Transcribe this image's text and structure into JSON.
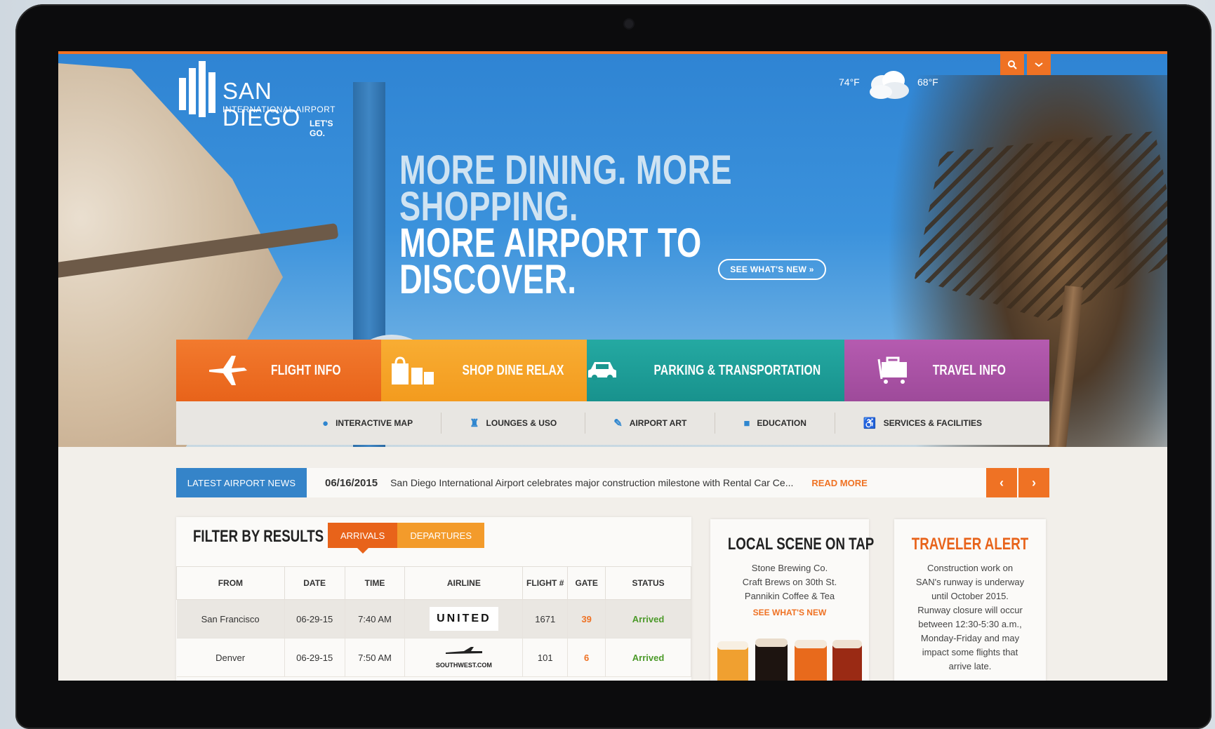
{
  "brand": {
    "name": "SAN DIEGO",
    "subtitle": "INTERNATIONAL AIRPORT",
    "tagline": "LET'S GO."
  },
  "weather": {
    "high": "74°F",
    "low": "68°F",
    "icon": "cloud-icon"
  },
  "hero": {
    "line1": "MORE DINING. MORE SHOPPING.",
    "line2": "MORE AIRPORT TO DISCOVER.",
    "cta": "SEE WHAT'S NEW »"
  },
  "nav_tiles": [
    {
      "label": "FLIGHT INFO",
      "icon": "airplane-icon",
      "color": "#ef7224"
    },
    {
      "label": "SHOP DINE RELAX",
      "icon": "shopping-bags-icon",
      "color": "#f5a52a"
    },
    {
      "label": "PARKING & TRANSPORTATION",
      "icon": "car-icon",
      "color": "#1fa19b"
    },
    {
      "label": "TRAVEL INFO",
      "icon": "luggage-icon",
      "color": "#a853a4"
    }
  ],
  "sub_nav": [
    {
      "label": "INTERACTIVE MAP",
      "icon": "map-pin-icon"
    },
    {
      "label": "LOUNGES & USO",
      "icon": "lounge-chair-icon"
    },
    {
      "label": "AIRPORT ART",
      "icon": "palette-icon"
    },
    {
      "label": "EDUCATION",
      "icon": "book-icon"
    },
    {
      "label": "SERVICES & FACILITIES",
      "icon": "accessibility-icon"
    }
  ],
  "news": {
    "label": "LATEST AIRPORT NEWS",
    "date": "06/16/2015",
    "text": "San Diego International Airport celebrates major construction milestone with Rental Car Ce...",
    "more": "READ MORE",
    "prev": "‹",
    "next": "›"
  },
  "flights": {
    "title": "FILTER BY RESULTS",
    "tabs": [
      "ARRIVALS",
      "DEPARTURES"
    ],
    "columns": [
      "FROM",
      "DATE",
      "TIME",
      "AIRLINE",
      "FLIGHT #",
      "GATE",
      "STATUS"
    ],
    "rows": [
      {
        "from": "San Francisco",
        "date": "06-29-15",
        "time": "7:40 AM",
        "airline": "UNITED",
        "flight": "1671",
        "gate": "39",
        "status": "Arrived"
      },
      {
        "from": "Denver",
        "date": "06-29-15",
        "time": "7:50 AM",
        "airline": "SOUTHWEST.COM",
        "flight": "101",
        "gate": "6",
        "status": "Arrived"
      }
    ]
  },
  "local_scene": {
    "title": "LOCAL SCENE ON TAP",
    "lines": [
      "Stone Brewing Co.",
      "Craft Brews on 30th St.",
      "Pannikin Coffee & Tea"
    ],
    "link": "SEE WHAT'S NEW"
  },
  "traveler_alert": {
    "title": "TRAVELER ALERT",
    "lines": [
      "Construction work on",
      "SAN's runway is underway",
      "until October 2015.",
      "Runway closure will occur",
      "between 12:30-5:30 a.m.,",
      "Monday-Friday and may",
      "impact some flights that",
      "arrive late."
    ]
  },
  "colors": {
    "accent": "#ef7224",
    "news_blue": "#3584c9",
    "status_green": "#4c9a2a"
  }
}
